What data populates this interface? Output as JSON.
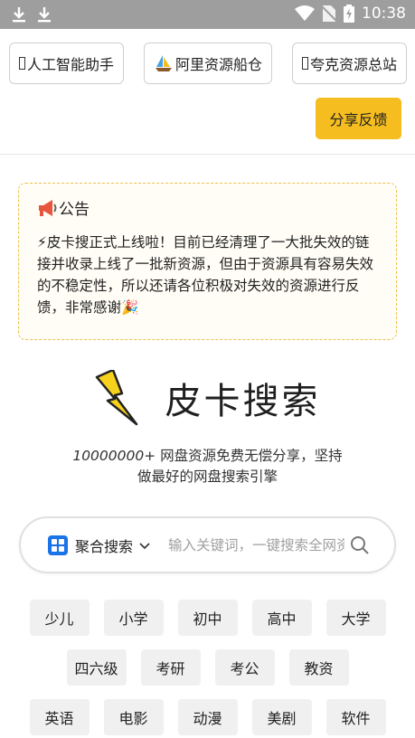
{
  "statusbar": {
    "time": "10:38"
  },
  "top_links": [
    {
      "label": "人工智能助手",
      "icon": "box-glyph"
    },
    {
      "label": "阿里资源船仓",
      "icon": "sailboat-icon"
    },
    {
      "label": "夸克资源总站",
      "icon": "box-glyph"
    }
  ],
  "feedback_label": "分享反馈",
  "notice": {
    "title": "公告",
    "body": "⚡皮卡搜正式上线啦！目前已经清理了一大批失效的链接并收录上线了一批新资源，但由于资源具有容易失效的不稳定性，所以还请各位积极对失效的资源进行反馈，非常感谢🎉"
  },
  "brand": {
    "name": "皮卡搜索"
  },
  "slogan": {
    "count": "10000000+",
    "text_1": " 网盘资源免费无偿分享，坚持",
    "text_2": "做最好的网盘搜索引擎"
  },
  "search": {
    "mode_label": "聚合搜索",
    "placeholder": "输入关键词，一键搜索全网资源"
  },
  "tags": [
    [
      "少儿",
      "小学",
      "初中",
      "高中",
      "大学"
    ],
    [
      "四六级",
      "考研",
      "考公",
      "教资"
    ],
    [
      "英语",
      "电影",
      "动漫",
      "美剧",
      "软件"
    ]
  ],
  "colors": {
    "accent": "#f5bd1f",
    "search_mode_icon": "#1a73e8",
    "notice_border": "#f0c24a"
  }
}
